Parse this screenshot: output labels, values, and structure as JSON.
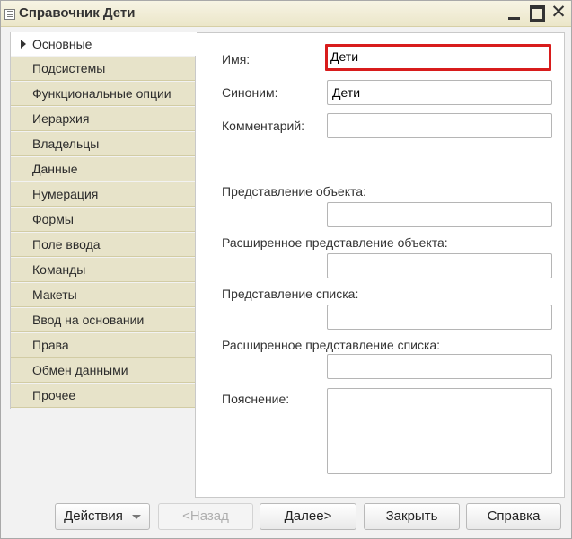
{
  "window": {
    "title": "Справочник Дети"
  },
  "tabs": [
    {
      "label": "Основные",
      "active": true
    },
    {
      "label": "Подсистемы"
    },
    {
      "label": "Функциональные опции"
    },
    {
      "label": "Иерархия"
    },
    {
      "label": "Владельцы"
    },
    {
      "label": "Данные"
    },
    {
      "label": "Нумерация"
    },
    {
      "label": "Формы"
    },
    {
      "label": "Поле ввода"
    },
    {
      "label": "Команды"
    },
    {
      "label": "Макеты"
    },
    {
      "label": "Ввод на основании"
    },
    {
      "label": "Права"
    },
    {
      "label": "Обмен данными"
    },
    {
      "label": "Прочее"
    }
  ],
  "form": {
    "name_label": "Имя:",
    "name_value": "Дети",
    "synonym_label": "Синоним:",
    "synonym_value": "Дети",
    "comment_label": "Комментарий:",
    "comment_value": "",
    "object_presentation_label": "Представление объекта:",
    "object_presentation_value": "",
    "extended_object_presentation_label": "Расширенное представление объекта:",
    "extended_object_presentation_value": "",
    "list_presentation_label": "Представление списка:",
    "list_presentation_value": "",
    "extended_list_presentation_label": "Расширенное представление списка:",
    "extended_list_presentation_value": "",
    "explanation_label": "Пояснение:",
    "explanation_value": ""
  },
  "buttons": {
    "actions": "Действия",
    "back": "<Назад",
    "next": "Далее>",
    "close": "Закрыть",
    "help": "Справка"
  },
  "colors": {
    "tab_background": "#e7e3c9",
    "focus_border": "#d81c1c",
    "titlebar": "#f7f4e4"
  }
}
